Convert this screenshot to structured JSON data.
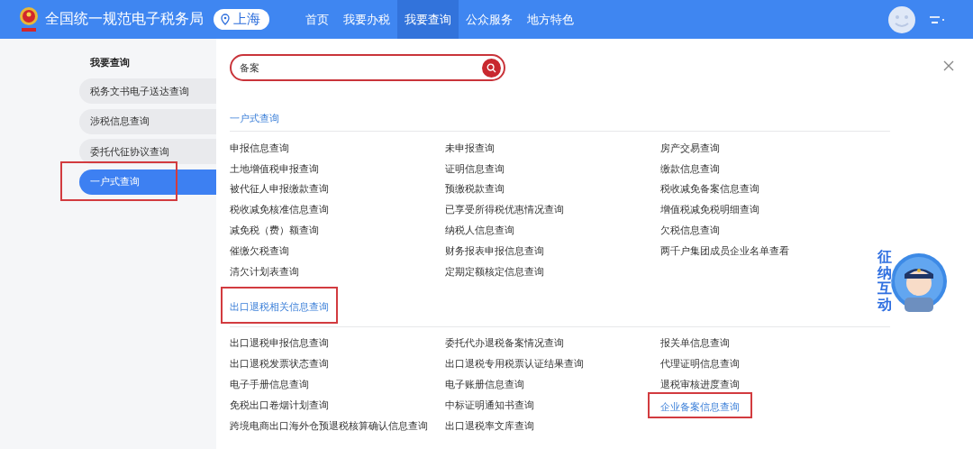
{
  "header": {
    "title": "全国统一规范电子税务局",
    "location": "上海",
    "nav": [
      {
        "label": "首页",
        "selected": false
      },
      {
        "label": "我要办税",
        "selected": false
      },
      {
        "label": "我要查询",
        "selected": true
      },
      {
        "label": "公众服务",
        "selected": false
      },
      {
        "label": "地方特色",
        "selected": false
      }
    ]
  },
  "sidebar": {
    "title": "我要查询",
    "items": [
      {
        "label": "税务文书电子送达查询",
        "selected": false,
        "highlighted": false
      },
      {
        "label": "涉税信息查询",
        "selected": false,
        "highlighted": false
      },
      {
        "label": "委托代征协议查询",
        "selected": false,
        "highlighted": false
      },
      {
        "label": "一户式查询",
        "selected": true,
        "highlighted": true
      }
    ]
  },
  "search": {
    "value": "备案"
  },
  "sections": [
    {
      "title": "一户式查询",
      "highlighted": false,
      "links": [
        {
          "label": "申报信息查询",
          "highlighted": false
        },
        {
          "label": "未申报查询",
          "highlighted": false
        },
        {
          "label": "房产交易查询",
          "highlighted": false
        },
        {
          "label": "土地增值税申报查询",
          "highlighted": false
        },
        {
          "label": "证明信息查询",
          "highlighted": false
        },
        {
          "label": "缴款信息查询",
          "highlighted": false
        },
        {
          "label": "被代征人申报缴款查询",
          "highlighted": false
        },
        {
          "label": "预缴税款查询",
          "highlighted": false
        },
        {
          "label": "税收减免备案信息查询",
          "highlighted": false
        },
        {
          "label": "税收减免核准信息查询",
          "highlighted": false
        },
        {
          "label": "已享受所得税优惠情况查询",
          "highlighted": false
        },
        {
          "label": "增值税减免税明细查询",
          "highlighted": false
        },
        {
          "label": "减免税（费）额查询",
          "highlighted": false
        },
        {
          "label": "纳税人信息查询",
          "highlighted": false
        },
        {
          "label": "欠税信息查询",
          "highlighted": false
        },
        {
          "label": "催缴欠税查询",
          "highlighted": false
        },
        {
          "label": "财务报表申报信息查询",
          "highlighted": false
        },
        {
          "label": "两千户集团成员企业名单查看",
          "highlighted": false
        },
        {
          "label": "清欠计划表查询",
          "highlighted": false
        },
        {
          "label": "定期定额核定信息查询",
          "highlighted": false
        }
      ]
    },
    {
      "title": "出口退税相关信息查询",
      "highlighted": true,
      "links": [
        {
          "label": "出口退税申报信息查询",
          "highlighted": false
        },
        {
          "label": "委托代办退税备案情况查询",
          "highlighted": false
        },
        {
          "label": "报关单信息查询",
          "highlighted": false
        },
        {
          "label": "出口退税发票状态查询",
          "highlighted": false
        },
        {
          "label": "出口退税专用税票认证结果查询",
          "highlighted": false
        },
        {
          "label": "代理证明信息查询",
          "highlighted": false
        },
        {
          "label": "电子手册信息查询",
          "highlighted": false
        },
        {
          "label": "电子账册信息查询",
          "highlighted": false
        },
        {
          "label": "退税审核进度查询",
          "highlighted": false
        },
        {
          "label": "免税出口卷烟计划查询",
          "highlighted": false
        },
        {
          "label": "中标证明通知书查询",
          "highlighted": false
        },
        {
          "label": "企业备案信息查询",
          "highlighted": true
        },
        {
          "label": "跨境电商出口海外仓预退税核算确认信息查询",
          "highlighted": false
        },
        {
          "label": "出口退税率文库查询",
          "highlighted": false
        }
      ]
    }
  ],
  "mascot": {
    "caption": "征纳互动"
  }
}
